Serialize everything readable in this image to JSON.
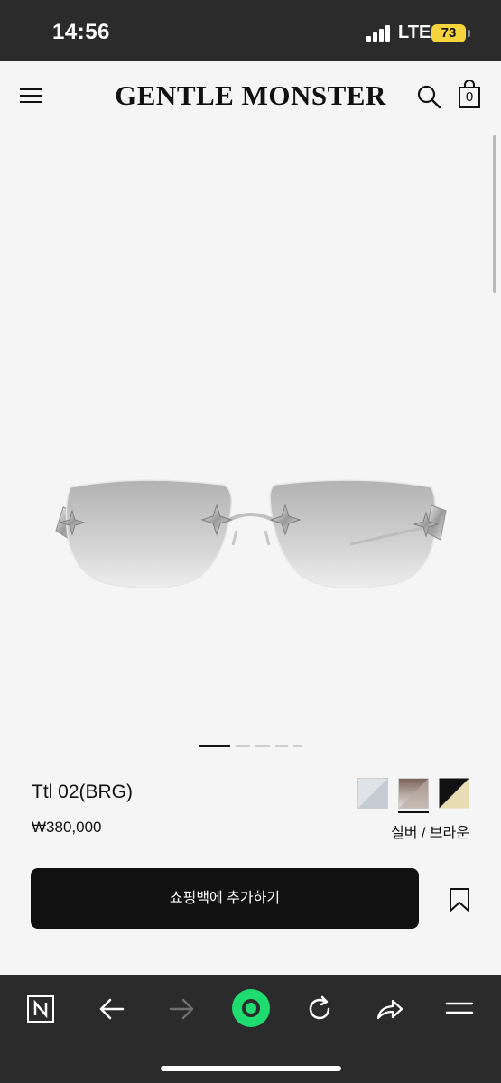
{
  "status_bar": {
    "time": "14:56",
    "network": "LTE",
    "battery": "73",
    "battery_color": "#f5d43c"
  },
  "header": {
    "brand": "GENTLE MONSTER",
    "bag_count": "0",
    "icons": [
      "menu-icon",
      "search-icon",
      "shopping-bag-icon"
    ]
  },
  "product": {
    "name": "Ttl 02(BRG)",
    "price": "₩380,000",
    "color_name": "실버 / 브라운",
    "image_count": 5,
    "active_image": 1,
    "swatches": [
      {
        "name": "silver",
        "colors": [
          "#dfe3e8",
          "#c5ccd4"
        ]
      },
      {
        "name": "brown-gradient",
        "colors": [
          "#8a7466",
          "#e8e4e2"
        ],
        "selected": true
      },
      {
        "name": "black-gold",
        "colors": [
          "#111111",
          "#e8dcb4"
        ]
      }
    ]
  },
  "actions": {
    "add_to_bag": "쇼핑백에 추가하기",
    "bookmark": "bookmark-icon"
  },
  "browser_toolbar": {
    "icons": [
      "naver-icon",
      "back-icon",
      "forward-icon",
      "green-dot-icon",
      "refresh-icon",
      "share-icon",
      "menu-icon"
    ],
    "accent": "#1fdc70"
  }
}
